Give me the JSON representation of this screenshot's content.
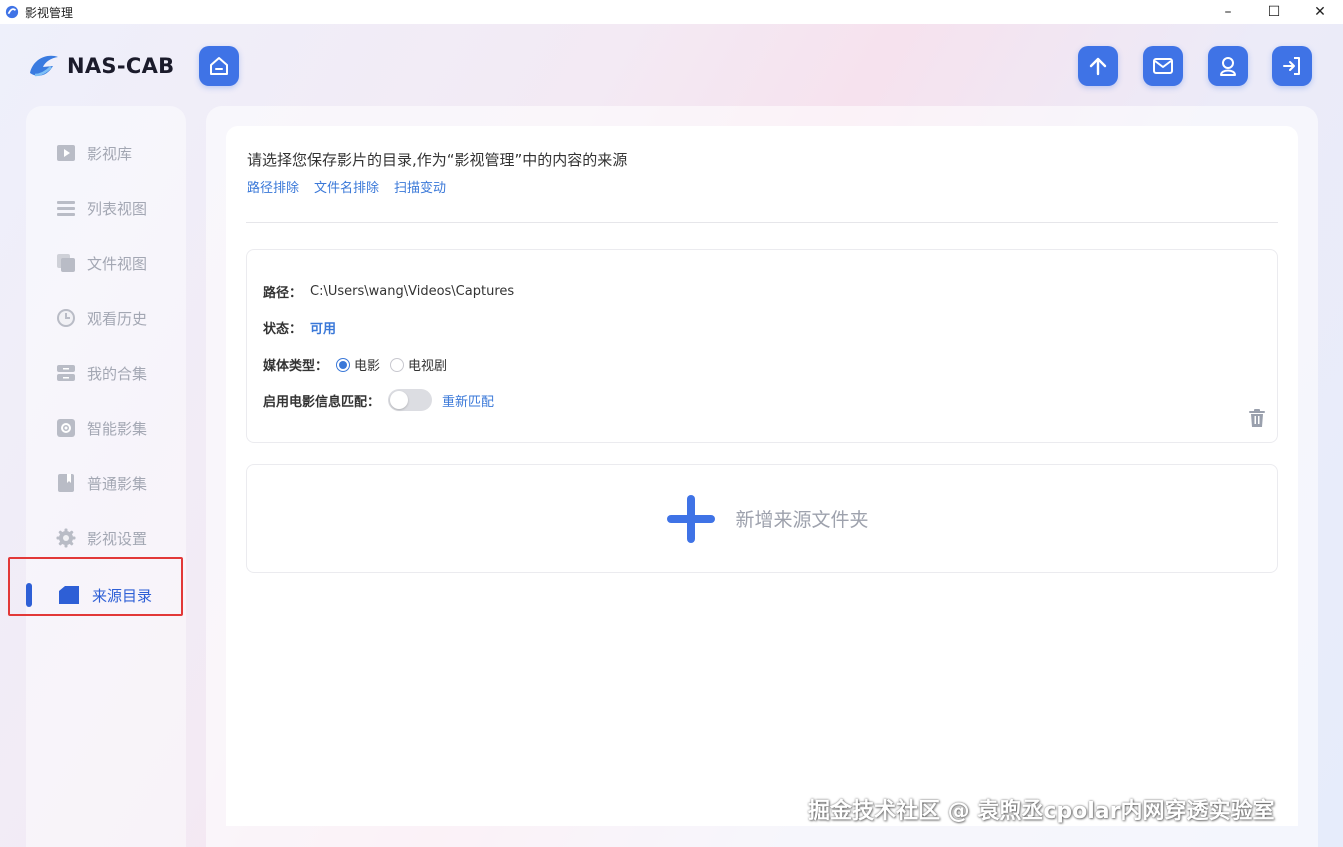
{
  "window": {
    "title": "影视管理",
    "minimize": "–",
    "maximize": "☐",
    "close": "✕"
  },
  "header": {
    "logo_text": "NAS-CAB"
  },
  "sidebar": {
    "items": [
      {
        "label": "影视库",
        "icon": "play-icon"
      },
      {
        "label": "列表视图",
        "icon": "list-icon"
      },
      {
        "label": "文件视图",
        "icon": "files-icon"
      },
      {
        "label": "观看历史",
        "icon": "clock-icon"
      },
      {
        "label": "我的合集",
        "icon": "collection-icon"
      },
      {
        "label": "智能影集",
        "icon": "smart-album-icon"
      },
      {
        "label": "普通影集",
        "icon": "book-icon"
      },
      {
        "label": "影视设置",
        "icon": "gear-icon"
      },
      {
        "label": "来源目录",
        "icon": "folder-icon",
        "active": true
      }
    ]
  },
  "main": {
    "intro": "请选择您保存影片的目录,作为“影视管理”中的内容的来源",
    "links": [
      "路径排除",
      "文件名排除",
      "扫描变动"
    ],
    "source": {
      "path_label": "路径：",
      "path_value": "C:\\Users\\wang\\Videos\\Captures",
      "status_label": "状态：",
      "status_value": "可用",
      "media_label": "媒体类型：",
      "media_options": [
        "电影",
        "电视剧"
      ],
      "media_selected": "电影",
      "match_label": "启用电影信息匹配：",
      "match_enabled": false,
      "rematch_label": "重新匹配"
    },
    "add_label": "新增来源文件夹"
  },
  "watermark": "掘金技术社区 @ 袁煦丞cpolar内网穿透实验室",
  "colors": {
    "accent": "#3f73e6",
    "link": "#3a78d8",
    "highlight": "#e23838"
  }
}
